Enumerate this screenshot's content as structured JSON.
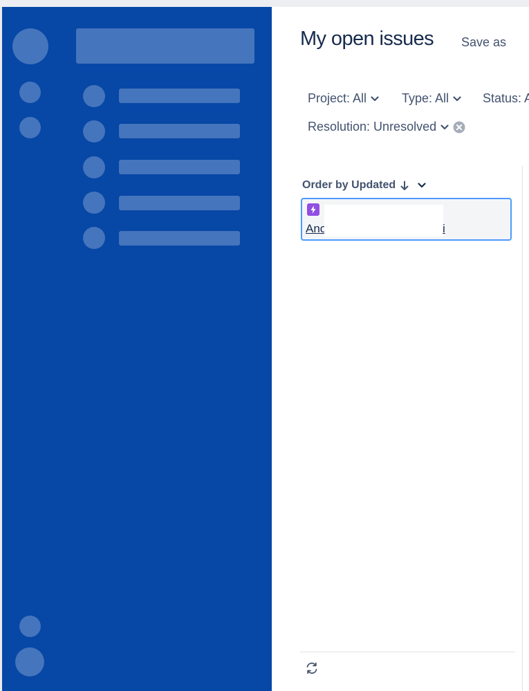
{
  "header": {
    "title": "My open issues",
    "save_as_label": "Save as"
  },
  "filters": {
    "project": "Project: All",
    "type": "Type: All",
    "status": "Status: A",
    "resolution": "Resolution: Unresolved"
  },
  "order": {
    "label": "Order by Updated"
  },
  "issue": {
    "summary_start": "Ano",
    "summary_end": "i",
    "type_icon": "lightning-bolt-icon",
    "type_color": "#904ee2"
  },
  "colors": {
    "nav_background": "#0747a6",
    "selected_border": "#4c9aff",
    "title_text": "#172b4d",
    "secondary_text": "#42526e"
  },
  "icons": {
    "chevron": "chevron-down-icon",
    "clear": "clear-filter-icon",
    "sort": "arrow-down-icon",
    "refresh": "refresh-icon"
  }
}
